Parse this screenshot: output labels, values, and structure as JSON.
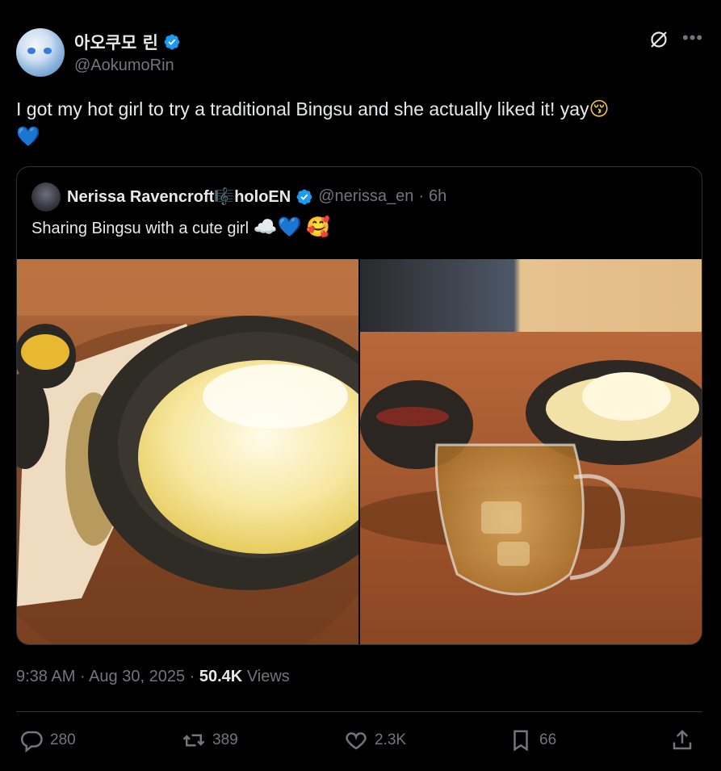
{
  "author": {
    "display_name": "아오쿠모 린",
    "handle": "@AokumoRin",
    "verified": true
  },
  "tweet": {
    "text": "I got my hot girl to try a traditional Bingsu and she actually liked it! yay",
    "emojis": [
      "kissing-face-emoji",
      "blue-heart-emoji"
    ]
  },
  "quoted_tweet": {
    "display_name": "Nerissa Ravencroft",
    "name_suffix": "holoEN",
    "handle": "@nerissa_en",
    "separator": "·",
    "time": "6h",
    "text": "Sharing Bingsu with a cute girl",
    "emojis": [
      "cloud-emoji",
      "blue-heart-emoji",
      "smiling-face-with-hearts-emoji"
    ]
  },
  "meta": {
    "time": "9:38 AM",
    "sep1": "·",
    "date": "Aug 30, 2025",
    "sep2": "·",
    "views_count": "50.4K",
    "views_label": "Views"
  },
  "actions": {
    "replies": "280",
    "reposts": "389",
    "likes": "2.3K",
    "bookmarks": "66"
  },
  "colors": {
    "background": "#000000",
    "text": "#e7e9ea",
    "muted": "#71767b",
    "verified": "#1d9bf0",
    "border": "#2f3336"
  }
}
